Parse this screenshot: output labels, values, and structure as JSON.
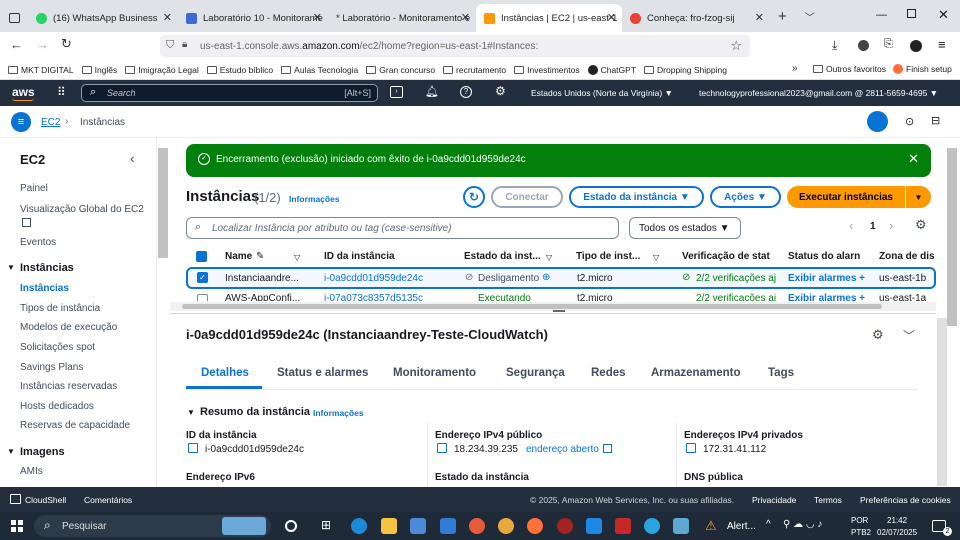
{
  "browser": {
    "tabs": [
      {
        "label": "(16) WhatsApp Business",
        "color": "#25d366"
      },
      {
        "label": "Laboratório 10 - Monitorame",
        "color": "#3d6bd6"
      },
      {
        "label": "* Laboratório - Monitoramento e",
        "color": "#dfe3e8"
      },
      {
        "label": "Instâncias | EC2 | us-east-1",
        "color": "#ff9900"
      },
      {
        "label": "Conheça: fro-fzog-sij",
        "color": "#ea4335"
      }
    ],
    "url_prefix": "us-east-1.console.aws.",
    "url_domain": "amazon.com",
    "url_suffix": "/ec2/home?region=us-east-1#Instances:",
    "bookmarks": [
      "MKT DIGITAL",
      "Inglês",
      "Imigração Legal",
      "Estudo bíblico",
      "Aulas Tecnologia",
      "Gran concurso",
      "recrutamento",
      "Investimentos",
      "ChatGPT",
      "Dropping Shipping"
    ],
    "bookmarks_right": [
      "Outros favoritos",
      "Finish setup"
    ]
  },
  "aws": {
    "logo": "aws",
    "search_placeholder": "Search",
    "search_shortcut": "[Alt+S]",
    "region": "Estados Unidos (Norte da Virgínia) ▼",
    "account": "technologyprofessional2023@gmail.com @ 2811-5659-4695 ▼"
  },
  "breadcrumb": {
    "service": "EC2",
    "page": "Instâncias"
  },
  "sidebar": {
    "title": "EC2",
    "items": [
      "Painel",
      "Visualização Global do EC2",
      "Eventos"
    ],
    "section1": "Instâncias",
    "section1_items": [
      "Instâncias",
      "Tipos de instância",
      "Modelos de execução",
      "Solicitações spot",
      "Savings Plans",
      "Instâncias reservadas",
      "Hosts dedicados",
      "Reservas de capacidade"
    ],
    "section2": "Imagens",
    "section2_items": [
      "AMIs"
    ]
  },
  "flash": {
    "message": "Encerramento (exclusão) iniciado com êxito de i-0a9cdd01d959de24c"
  },
  "instances": {
    "title": "Instâncias",
    "count": "(1/2)",
    "info": "Informações",
    "buttons": {
      "connect": "Conectar",
      "state": "Estado da instância ▼",
      "actions": "Ações ▼",
      "launch": "Executar instâncias"
    },
    "search_placeholder": "Localizar Instância por atributo ou tag (case-sensitive)",
    "filter": "Todos os estados ▼",
    "page": "1",
    "columns": [
      "Name",
      "ID da instância",
      "Estado da inst...",
      "Tipo de inst...",
      "Verificação de stat",
      "Status do alarn",
      "Zona de dis"
    ],
    "rows": [
      {
        "name": "Instanciaandre...",
        "id": "i-0a9cdd01d959de24c",
        "state": "Desligamento",
        "type": "t2.micro",
        "check": "2/2 verificações aj",
        "alarm": "Exibir alarmes +",
        "zone": "us-east-1b"
      },
      {
        "name": "AWS-AppConfi...",
        "id": "i-07a073c8357d5135c",
        "state": "Executando",
        "type": "t2.micro",
        "check": "2/2 verificações aj",
        "alarm": "Exibir alarmes +",
        "zone": "us-east-1a"
      }
    ]
  },
  "detail": {
    "title": "i-0a9cdd01d959de24c (Instanciaandrey-Teste-CloudWatch)",
    "tabs": [
      "Detalhes",
      "Status e alarmes",
      "Monitoramento",
      "Segurança",
      "Redes",
      "Armazenamento",
      "Tags"
    ],
    "summary": "Resumo da instância",
    "info": "Informações",
    "f1_label": "ID da instância",
    "f1_value": "i-0a9cdd01d959de24c",
    "f2_label": "Endereço IPv4 público",
    "f2_value": "18.234.39.235",
    "f2_link": "endereço aberto",
    "f3_label": "Endereços IPv4 privados",
    "f3_value": "172.31.41.112",
    "f4_label": "Endereço IPv6",
    "f5_label": "Estado da instância",
    "f6_label": "DNS pública"
  },
  "footer": {
    "cloudshell": "CloudShell",
    "comments": "Comentários",
    "copyright": "© 2025, Amazon Web Services, Inc. ou suas afiliadas.",
    "privacy": "Privacidade",
    "terms": "Termos",
    "cookies": "Preferências de cookies"
  },
  "taskbar": {
    "search": "Pesquisar",
    "alert": "Alert...",
    "lang1": "POR",
    "lang2": "PTB2",
    "time": "21:42",
    "date": "02/07/2025",
    "notif": "2"
  }
}
